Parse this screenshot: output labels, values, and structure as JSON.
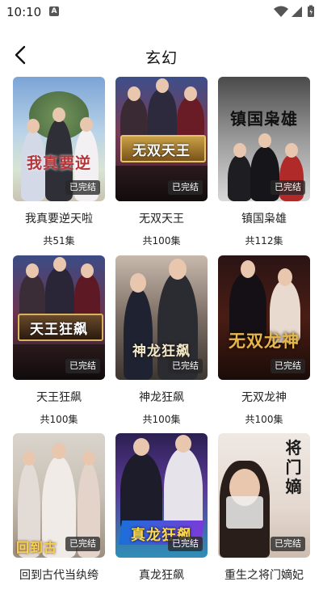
{
  "status": {
    "time": "10:10",
    "notif_letter": "A"
  },
  "header": {
    "title": "玄幻"
  },
  "badge_text": "已完结",
  "items": [
    {
      "title": "我真要逆天啦",
      "count": "共51集",
      "cover_text": "我真要逆"
    },
    {
      "title": "无双天王",
      "count": "共100集",
      "cover_text": "无双天王"
    },
    {
      "title": "镇国枭雄",
      "count": "共112集",
      "cover_text": "镇国枭雄"
    },
    {
      "title": "天王狂飙",
      "count": "共100集",
      "cover_text": "天王狂飙"
    },
    {
      "title": "神龙狂飙",
      "count": "共100集",
      "cover_text": "神龙狂飙"
    },
    {
      "title": "无双龙神",
      "count": "共100集",
      "cover_text": "无双龙神"
    },
    {
      "title": "回到古代当纨绔",
      "count": "",
      "cover_text": "回到古"
    },
    {
      "title": "真龙狂飙",
      "count": "",
      "cover_text": "真龙狂飙"
    },
    {
      "title": "重生之将门嫡妃",
      "count": "",
      "cover_text": "将门嫡"
    }
  ]
}
